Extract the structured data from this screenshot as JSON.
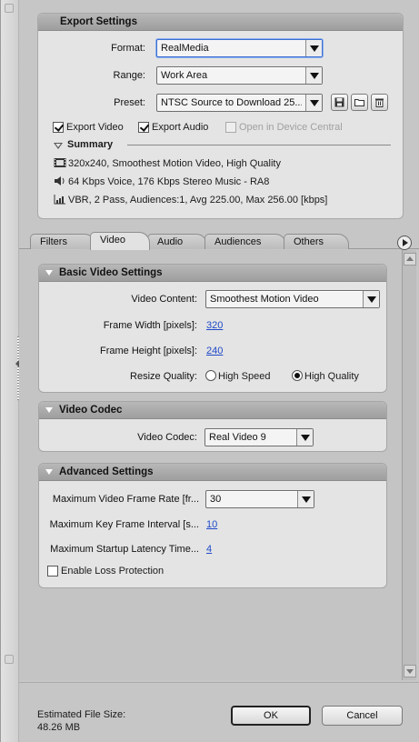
{
  "export_settings": {
    "title": "Export Settings",
    "format": {
      "label": "Format:",
      "value": "RealMedia"
    },
    "range": {
      "label": "Range:",
      "value": "Work Area"
    },
    "preset": {
      "label": "Preset:",
      "value": "NTSC Source to Download 25..."
    },
    "export_video": {
      "label": "Export Video",
      "checked": true
    },
    "export_audio": {
      "label": "Export Audio",
      "checked": true
    },
    "open_device_central": {
      "label": "Open in Device Central",
      "checked": false,
      "disabled": true
    },
    "summary": {
      "title": "Summary",
      "lines": [
        {
          "icon": "film-icon",
          "text": "320x240, Smoothest Motion Video, High Quality"
        },
        {
          "icon": "speaker-icon",
          "text": "64 Kbps Voice, 176 Kbps Stereo Music - RA8"
        },
        {
          "icon": "bitrate-chart-icon",
          "text": "VBR, 2 Pass, Audiences:1, Avg 225.00, Max 256.00 [kbps]"
        }
      ]
    }
  },
  "tabs": [
    {
      "label": "Filters",
      "active": false
    },
    {
      "label": "Video",
      "active": true
    },
    {
      "label": "Audio",
      "active": false
    },
    {
      "label": "Audiences",
      "active": false
    },
    {
      "label": "Others",
      "active": false
    }
  ],
  "basic_video": {
    "title": "Basic Video Settings",
    "video_content": {
      "label": "Video Content:",
      "value": "Smoothest Motion Video"
    },
    "frame_width": {
      "label": "Frame Width [pixels]:",
      "value": "320"
    },
    "frame_height": {
      "label": "Frame Height [pixels]:",
      "value": "240"
    },
    "resize_quality": {
      "label": "Resize Quality:",
      "options": [
        "High Speed",
        "High Quality"
      ],
      "selected": "High Quality"
    }
  },
  "video_codec": {
    "title": "Video Codec",
    "codec": {
      "label": "Video Codec:",
      "value": "Real Video 9"
    }
  },
  "advanced": {
    "title": "Advanced Settings",
    "max_frame_rate": {
      "label": "Maximum Video Frame Rate [fr...",
      "value": "30"
    },
    "max_key_frame": {
      "label": "Maximum Key Frame Interval [s...",
      "value": "10"
    },
    "max_startup_latency": {
      "label": "Maximum Startup Latency Time...",
      "value": "4"
    },
    "enable_loss_protection": {
      "label": "Enable Loss Protection",
      "checked": false
    }
  },
  "footer": {
    "estimated_label": "Estimated File Size:",
    "estimated_value": "48.26 MB",
    "ok": "OK",
    "cancel": "Cancel"
  }
}
